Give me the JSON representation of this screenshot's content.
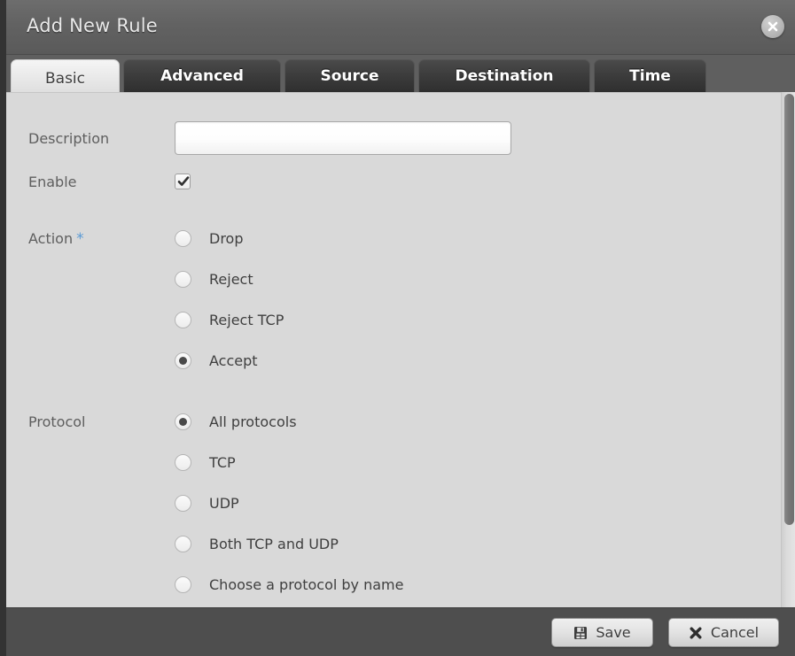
{
  "dialog": {
    "title": "Add New Rule",
    "close_icon": "close-icon"
  },
  "tabs": [
    {
      "label": "Basic",
      "active": true
    },
    {
      "label": "Advanced",
      "active": false
    },
    {
      "label": "Source",
      "active": false
    },
    {
      "label": "Destination",
      "active": false
    },
    {
      "label": "Time",
      "active": false
    }
  ],
  "form": {
    "description": {
      "label": "Description",
      "value": "",
      "placeholder": ""
    },
    "enable": {
      "label": "Enable",
      "checked": true
    },
    "action": {
      "label": "Action",
      "required_marker": "*",
      "options": [
        {
          "label": "Drop",
          "selected": false
        },
        {
          "label": "Reject",
          "selected": false
        },
        {
          "label": "Reject TCP",
          "selected": false
        },
        {
          "label": "Accept",
          "selected": true
        }
      ]
    },
    "protocol": {
      "label": "Protocol",
      "options": [
        {
          "label": "All protocols",
          "selected": true
        },
        {
          "label": "TCP",
          "selected": false
        },
        {
          "label": "UDP",
          "selected": false
        },
        {
          "label": "Both TCP and UDP",
          "selected": false
        },
        {
          "label": "Choose a protocol by name",
          "selected": false
        }
      ]
    }
  },
  "footer": {
    "save_label": "Save",
    "save_icon": "save-floppy-icon",
    "cancel_label": "Cancel",
    "cancel_icon": "cancel-x-icon"
  },
  "colors": {
    "required_star": "#5b9bd5",
    "titlebar": "#626262",
    "content_bg": "#d9d9d9",
    "footer_bg": "#4e4e4e",
    "tab_active_bg": "#e6e6e6",
    "tab_inactive_bg": "#3a3a3a"
  }
}
